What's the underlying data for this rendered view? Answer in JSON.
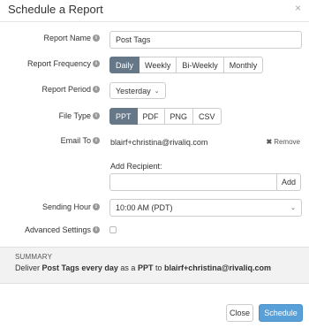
{
  "modal": {
    "title": "Schedule a Report",
    "close_glyph": "×"
  },
  "fields": {
    "report_name": {
      "label": "Report Name",
      "value": "Post Tags"
    },
    "report_frequency": {
      "label": "Report Frequency",
      "options": [
        "Daily",
        "Weekly",
        "Bi-Weekly",
        "Monthly"
      ],
      "selected": "Daily"
    },
    "report_period": {
      "label": "Report Period",
      "value": "Yesterday"
    },
    "file_type": {
      "label": "File Type",
      "options": [
        "PPT",
        "PDF",
        "PNG",
        "CSV"
      ],
      "selected": "PPT"
    },
    "email_to": {
      "label": "Email To",
      "email": "blairf+christina@rivaliq.com",
      "remove_label": "Remove"
    },
    "add_recipient": {
      "label": "Add Recipient:",
      "value": "",
      "button_label": "Add"
    },
    "sending_hour": {
      "label": "Sending Hour",
      "value": "10:00 AM (PDT)"
    },
    "advanced_settings": {
      "label": "Advanced Settings",
      "checked": false
    }
  },
  "summary": {
    "heading": "SUMMARY",
    "prefix": "Deliver ",
    "report": "Post Tags",
    "freq": "every day",
    "mid": " as a ",
    "format": "PPT",
    "to": " to ",
    "email": "blairf+christina@rivaliq.com"
  },
  "footer": {
    "close_label": "Close",
    "schedule_label": "Schedule"
  },
  "colors": {
    "active_segment": "#667788",
    "primary_button": "#5aa0d8",
    "summary_bg": "#f2f2f2"
  }
}
